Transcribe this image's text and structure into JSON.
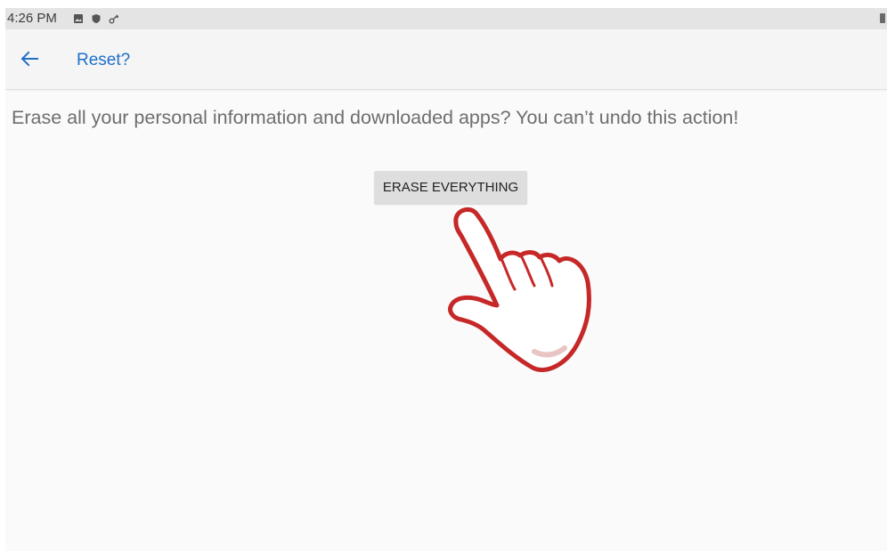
{
  "status_bar": {
    "time": "4:26 PM",
    "icons": [
      "image-icon",
      "shield-icon",
      "key-icon",
      "battery-icon"
    ]
  },
  "app_bar": {
    "title": "Reset?",
    "back_icon": "arrow-left-icon"
  },
  "main": {
    "message": "Erase all your personal information and downloaded apps? You can’t undo this action!",
    "erase_button_label": "ERASE EVERYTHING",
    "annotation_icon": "hand-pointer-icon"
  },
  "colors": {
    "accent": "#1e6fc8",
    "pointer_outline": "#c62828",
    "background": "#fafafa"
  }
}
